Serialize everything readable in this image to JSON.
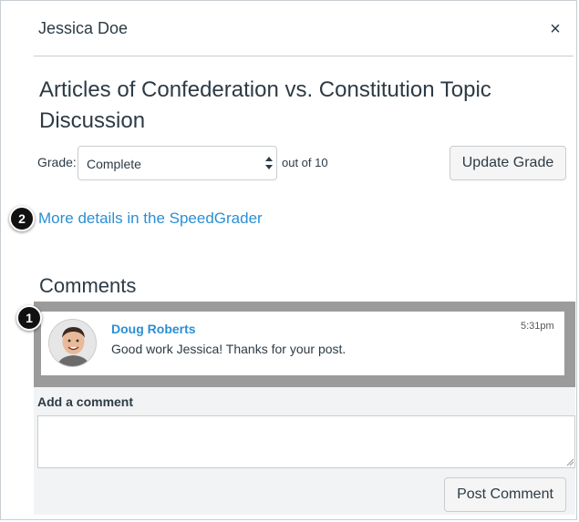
{
  "header": {
    "student_name": "Jessica Doe",
    "close_label": "×"
  },
  "assignment": {
    "title": "Articles of Confederation vs. Constitution Topic Discussion"
  },
  "grade": {
    "label": "Grade:",
    "selected_value": "Complete",
    "out_of": "out of 10",
    "update_button": "Update Grade"
  },
  "callouts": {
    "first": "1",
    "second": "2"
  },
  "speedgrader_link": "More details in the SpeedGrader",
  "comments": {
    "heading": "Comments",
    "items": [
      {
        "author": "Doug Roberts",
        "time": "5:31pm",
        "text": "Good work Jessica! Thanks for your post."
      }
    ]
  },
  "add_comment": {
    "label": "Add a comment",
    "placeholder": "",
    "post_button": "Post Comment"
  },
  "colors": {
    "link": "#2b8fd4",
    "text": "#2d3b45",
    "highlight": "#9b9b9b"
  }
}
